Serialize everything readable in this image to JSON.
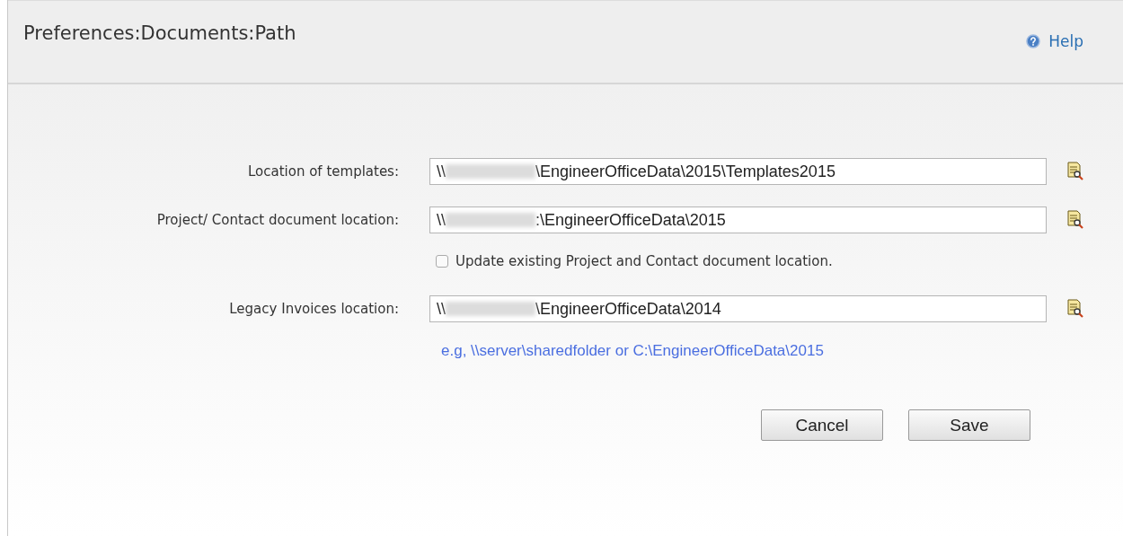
{
  "header": {
    "title": "Preferences:Documents:Path",
    "help": "Help"
  },
  "fields": [
    {
      "label": "Location of templates:",
      "prefix": "\\\\",
      "redacted": true,
      "value": "\\EngineerOfficeData\\2015\\Templates2015"
    },
    {
      "label": "Project/ Contact document location:",
      "prefix": "\\\\",
      "redacted": true,
      "value": ":\\EngineerOfficeData\\2015",
      "checkbox": {
        "label": "Update existing Project and Contact document location.",
        "checked": false
      }
    },
    {
      "label": "Legacy Invoices location:",
      "prefix": "\\\\",
      "redacted": true,
      "value": "\\EngineerOfficeData\\2014"
    }
  ],
  "hint": "e.g, \\\\server\\sharedfolder or C:\\EngineerOfficeData\\2015",
  "buttons": [
    "Cancel",
    "Save"
  ]
}
